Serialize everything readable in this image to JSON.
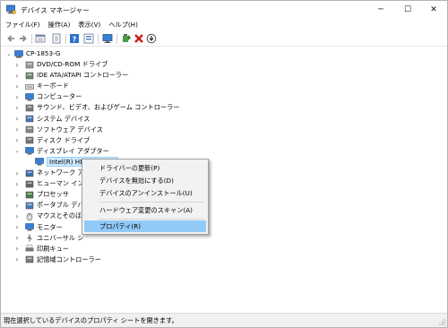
{
  "window": {
    "title": "デバイス マネージャー"
  },
  "window_controls": {
    "minimize": "─",
    "maximize": "☐",
    "close": "✕"
  },
  "menu": [
    "ファイル(F)",
    "操作(A)",
    "表示(V)",
    "ヘルプ(H)"
  ],
  "toolbar": {
    "buttons": [
      "back-icon",
      "forward-icon",
      "tree-view-icon",
      "properties-icon",
      "help-icon",
      "list-icon",
      "monitor-icon",
      "update-driver-icon",
      "uninstall-icon",
      "disable-icon"
    ]
  },
  "tree": {
    "root": "CP-1853-G",
    "nodes": [
      {
        "label": "DVD/CD-ROM ドライブ",
        "icon": "dvd-drive-icon",
        "expanded": false
      },
      {
        "label": "IDE ATA/ATAPI コントローラー",
        "icon": "ide-controller-icon",
        "expanded": false
      },
      {
        "label": "キーボード",
        "icon": "keyboard-icon",
        "expanded": false
      },
      {
        "label": "コンピューター",
        "icon": "computer-icon",
        "expanded": false
      },
      {
        "label": "サウンド、ビデオ、およびゲーム コントローラー",
        "icon": "sound-icon",
        "expanded": false
      },
      {
        "label": "システム デバイス",
        "icon": "system-device-icon",
        "expanded": false
      },
      {
        "label": "ソフトウェア デバイス",
        "icon": "software-device-icon",
        "expanded": false
      },
      {
        "label": "ディスク ドライブ",
        "icon": "disk-drive-icon",
        "expanded": false
      },
      {
        "label": "ディスプレイ アダプター",
        "icon": "display-adapter-icon",
        "expanded": true
      },
      {
        "label": "Intel(R) HD Graphics",
        "icon": "display-adapter-icon",
        "child": true,
        "selected": true
      },
      {
        "label": "ネットワーク アダ",
        "icon": "network-adapter-icon",
        "expanded": false
      },
      {
        "label": "ヒューマン インタ",
        "icon": "hid-icon",
        "expanded": false
      },
      {
        "label": "プロセッサ",
        "icon": "processor-icon",
        "expanded": false
      },
      {
        "label": "ポータブル デバイ",
        "icon": "portable-device-icon",
        "expanded": false
      },
      {
        "label": "マウスとそのほか",
        "icon": "mouse-icon",
        "expanded": false
      },
      {
        "label": "モニター",
        "icon": "monitor-icon",
        "expanded": false
      },
      {
        "label": "ユニバーサル シ",
        "icon": "usb-icon",
        "expanded": false
      },
      {
        "label": "印刷キュー",
        "icon": "printer-icon",
        "expanded": false
      },
      {
        "label": "記憶域コントローラー",
        "icon": "storage-controller-icon",
        "expanded": false
      }
    ]
  },
  "context_menu": {
    "items": [
      "ドライバーの更新(P)",
      "デバイスを無効にする(D)",
      "デバイスのアンインストール(U)",
      "ハードウェア変更のスキャン(A)",
      "プロパティ(R)"
    ]
  },
  "status": {
    "text": "現在選択しているデバイスのプロパティ シートを開きます。"
  },
  "colors": {
    "selection": "#cce8ff",
    "menu_highlight": "#91c9f7",
    "status_bg": "#f0f0f0"
  }
}
